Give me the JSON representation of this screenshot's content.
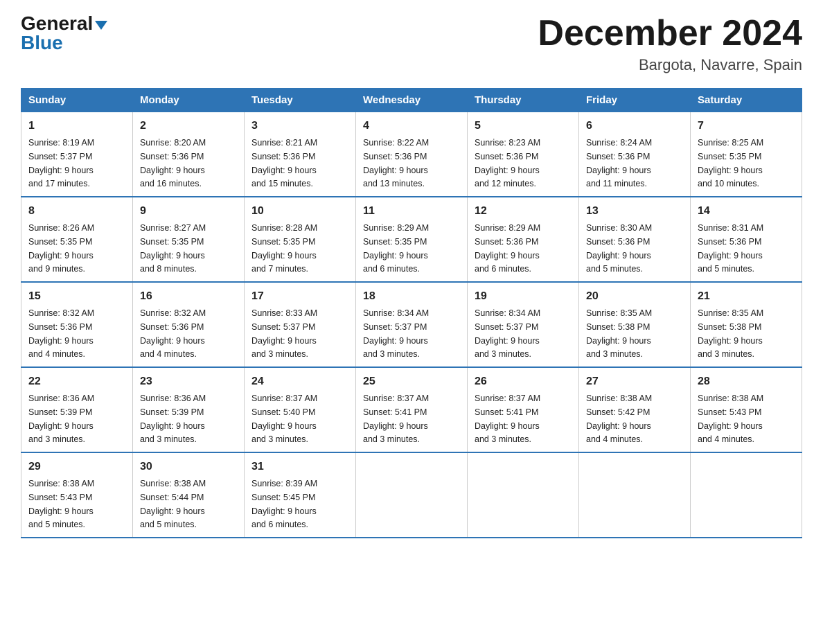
{
  "logo": {
    "general": "General",
    "blue": "Blue"
  },
  "title": "December 2024",
  "location": "Bargota, Navarre, Spain",
  "days_of_week": [
    "Sunday",
    "Monday",
    "Tuesday",
    "Wednesday",
    "Thursday",
    "Friday",
    "Saturday"
  ],
  "weeks": [
    [
      {
        "day": "1",
        "sunrise": "8:19 AM",
        "sunset": "5:37 PM",
        "daylight": "9 hours and 17 minutes."
      },
      {
        "day": "2",
        "sunrise": "8:20 AM",
        "sunset": "5:36 PM",
        "daylight": "9 hours and 16 minutes."
      },
      {
        "day": "3",
        "sunrise": "8:21 AM",
        "sunset": "5:36 PM",
        "daylight": "9 hours and 15 minutes."
      },
      {
        "day": "4",
        "sunrise": "8:22 AM",
        "sunset": "5:36 PM",
        "daylight": "9 hours and 13 minutes."
      },
      {
        "day": "5",
        "sunrise": "8:23 AM",
        "sunset": "5:36 PM",
        "daylight": "9 hours and 12 minutes."
      },
      {
        "day": "6",
        "sunrise": "8:24 AM",
        "sunset": "5:36 PM",
        "daylight": "9 hours and 11 minutes."
      },
      {
        "day": "7",
        "sunrise": "8:25 AM",
        "sunset": "5:35 PM",
        "daylight": "9 hours and 10 minutes."
      }
    ],
    [
      {
        "day": "8",
        "sunrise": "8:26 AM",
        "sunset": "5:35 PM",
        "daylight": "9 hours and 9 minutes."
      },
      {
        "day": "9",
        "sunrise": "8:27 AM",
        "sunset": "5:35 PM",
        "daylight": "9 hours and 8 minutes."
      },
      {
        "day": "10",
        "sunrise": "8:28 AM",
        "sunset": "5:35 PM",
        "daylight": "9 hours and 7 minutes."
      },
      {
        "day": "11",
        "sunrise": "8:29 AM",
        "sunset": "5:35 PM",
        "daylight": "9 hours and 6 minutes."
      },
      {
        "day": "12",
        "sunrise": "8:29 AM",
        "sunset": "5:36 PM",
        "daylight": "9 hours and 6 minutes."
      },
      {
        "day": "13",
        "sunrise": "8:30 AM",
        "sunset": "5:36 PM",
        "daylight": "9 hours and 5 minutes."
      },
      {
        "day": "14",
        "sunrise": "8:31 AM",
        "sunset": "5:36 PM",
        "daylight": "9 hours and 5 minutes."
      }
    ],
    [
      {
        "day": "15",
        "sunrise": "8:32 AM",
        "sunset": "5:36 PM",
        "daylight": "9 hours and 4 minutes."
      },
      {
        "day": "16",
        "sunrise": "8:32 AM",
        "sunset": "5:36 PM",
        "daylight": "9 hours and 4 minutes."
      },
      {
        "day": "17",
        "sunrise": "8:33 AM",
        "sunset": "5:37 PM",
        "daylight": "9 hours and 3 minutes."
      },
      {
        "day": "18",
        "sunrise": "8:34 AM",
        "sunset": "5:37 PM",
        "daylight": "9 hours and 3 minutes."
      },
      {
        "day": "19",
        "sunrise": "8:34 AM",
        "sunset": "5:37 PM",
        "daylight": "9 hours and 3 minutes."
      },
      {
        "day": "20",
        "sunrise": "8:35 AM",
        "sunset": "5:38 PM",
        "daylight": "9 hours and 3 minutes."
      },
      {
        "day": "21",
        "sunrise": "8:35 AM",
        "sunset": "5:38 PM",
        "daylight": "9 hours and 3 minutes."
      }
    ],
    [
      {
        "day": "22",
        "sunrise": "8:36 AM",
        "sunset": "5:39 PM",
        "daylight": "9 hours and 3 minutes."
      },
      {
        "day": "23",
        "sunrise": "8:36 AM",
        "sunset": "5:39 PM",
        "daylight": "9 hours and 3 minutes."
      },
      {
        "day": "24",
        "sunrise": "8:37 AM",
        "sunset": "5:40 PM",
        "daylight": "9 hours and 3 minutes."
      },
      {
        "day": "25",
        "sunrise": "8:37 AM",
        "sunset": "5:41 PM",
        "daylight": "9 hours and 3 minutes."
      },
      {
        "day": "26",
        "sunrise": "8:37 AM",
        "sunset": "5:41 PM",
        "daylight": "9 hours and 3 minutes."
      },
      {
        "day": "27",
        "sunrise": "8:38 AM",
        "sunset": "5:42 PM",
        "daylight": "9 hours and 4 minutes."
      },
      {
        "day": "28",
        "sunrise": "8:38 AM",
        "sunset": "5:43 PM",
        "daylight": "9 hours and 4 minutes."
      }
    ],
    [
      {
        "day": "29",
        "sunrise": "8:38 AM",
        "sunset": "5:43 PM",
        "daylight": "9 hours and 5 minutes."
      },
      {
        "day": "30",
        "sunrise": "8:38 AM",
        "sunset": "5:44 PM",
        "daylight": "9 hours and 5 minutes."
      },
      {
        "day": "31",
        "sunrise": "8:39 AM",
        "sunset": "5:45 PM",
        "daylight": "9 hours and 6 minutes."
      },
      null,
      null,
      null,
      null
    ]
  ],
  "labels": {
    "sunrise": "Sunrise:",
    "sunset": "Sunset:",
    "daylight": "Daylight:"
  }
}
